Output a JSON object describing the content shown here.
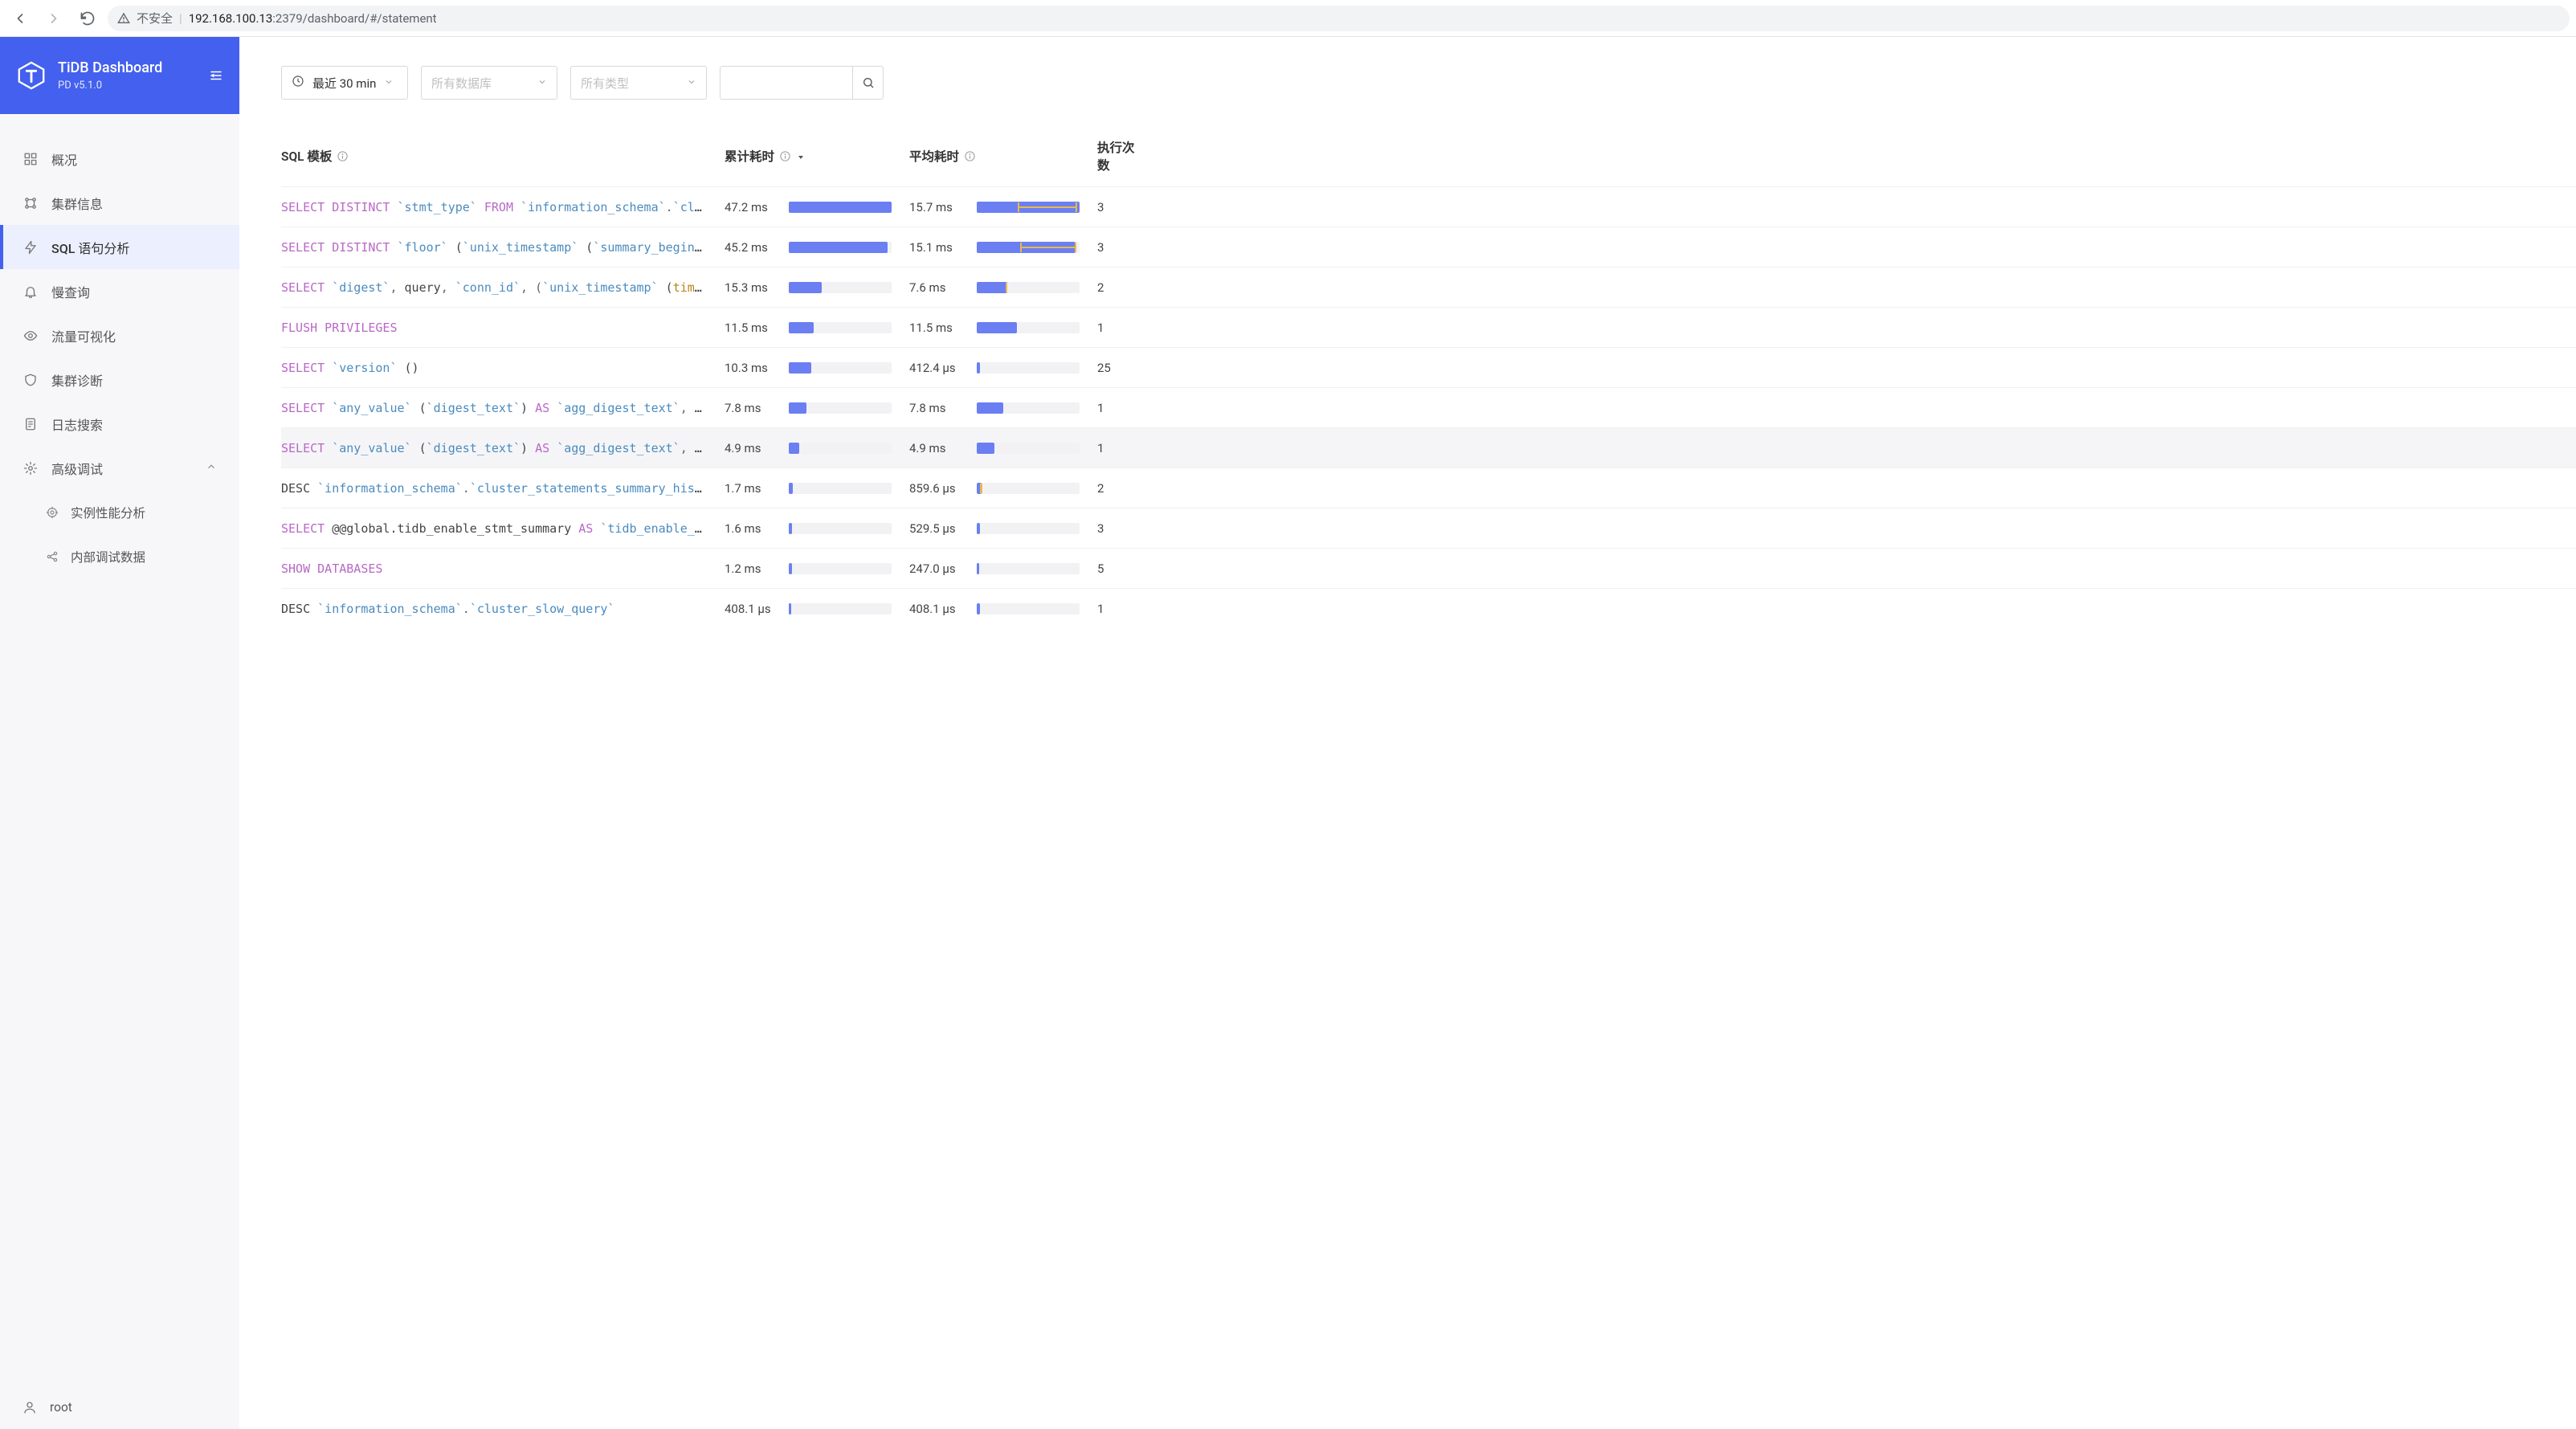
{
  "browser": {
    "insecure_label": "不安全",
    "url_host": "192.168.100.13",
    "url_port": ":2379",
    "url_path": "/dashboard/#/statement"
  },
  "sidebar": {
    "title": "TiDB Dashboard",
    "subtitle": "PD v5.1.0",
    "items": [
      {
        "label": "概况"
      },
      {
        "label": "集群信息"
      },
      {
        "label": "SQL 语句分析"
      },
      {
        "label": "慢查询"
      },
      {
        "label": "流量可视化"
      },
      {
        "label": "集群诊断"
      },
      {
        "label": "日志搜索"
      },
      {
        "label": "高级调试"
      }
    ],
    "sub_items": [
      {
        "label": "实例性能分析"
      },
      {
        "label": "内部调试数据"
      }
    ],
    "footer_user": "root"
  },
  "toolbar": {
    "time_label": "最近 30 min",
    "db_placeholder": "所有数据库",
    "type_placeholder": "所有类型"
  },
  "columns": {
    "sql": "SQL 模板",
    "sum": "累计耗时",
    "avg": "平均耗时",
    "count": "执行次数"
  },
  "chart_data": {
    "type": "table",
    "columns": [
      "sql_template",
      "sum_latency",
      "avg_latency",
      "exec_count"
    ],
    "max_sum_ms": 47.2,
    "max_avg_ms": 15.7,
    "rows": [
      {
        "sum": "47.2 ms",
        "sum_pct": 100,
        "avg": "15.7 ms",
        "avg_pct": 100,
        "whisker_lo": 40,
        "whisker_hi": 98,
        "count": "3"
      },
      {
        "sum": "45.2 ms",
        "sum_pct": 96,
        "avg": "15.1 ms",
        "avg_pct": 96,
        "whisker_lo": 42,
        "whisker_hi": 97,
        "count": "3"
      },
      {
        "sum": "15.3 ms",
        "sum_pct": 32,
        "avg": "7.6 ms",
        "avg_pct": 30,
        "whisker_lo": 28,
        "whisker_hi": 30,
        "count": "2"
      },
      {
        "sum": "11.5 ms",
        "sum_pct": 24,
        "avg": "11.5 ms",
        "avg_pct": 39,
        "count": "1"
      },
      {
        "sum": "10.3 ms",
        "sum_pct": 22,
        "avg": "412.4 µs",
        "avg_pct": 3,
        "count": "25"
      },
      {
        "sum": "7.8 ms",
        "sum_pct": 17,
        "avg": "7.8 ms",
        "avg_pct": 26,
        "count": "1"
      },
      {
        "sum": "4.9 ms",
        "sum_pct": 10,
        "avg": "4.9 ms",
        "avg_pct": 17,
        "count": "1",
        "hover": true
      },
      {
        "sum": "1.7 ms",
        "sum_pct": 4,
        "avg": "859.6 µs",
        "avg_pct": 5,
        "whisker_lo": 4,
        "whisker_hi": 5,
        "count": "2"
      },
      {
        "sum": "1.6 ms",
        "sum_pct": 3,
        "avg": "529.5 µs",
        "avg_pct": 3,
        "count": "3"
      },
      {
        "sum": "1.2 ms",
        "sum_pct": 3,
        "avg": "247.0 µs",
        "avg_pct": 2,
        "count": "5"
      },
      {
        "sum": "408.1 µs",
        "sum_pct": 2,
        "avg": "408.1 µs",
        "avg_pct": 3,
        "count": "1"
      }
    ]
  },
  "sql_rows": [
    {
      "tokens": [
        [
          "kw",
          "SELECT DISTINCT"
        ],
        [
          "plain",
          " "
        ],
        [
          "id",
          "`stmt_type`"
        ],
        [
          "plain",
          " "
        ],
        [
          "kw",
          "FROM"
        ],
        [
          "plain",
          " "
        ],
        [
          "id",
          "`information_schema`"
        ],
        [
          "op",
          "."
        ],
        [
          "id",
          "`clus…"
        ]
      ]
    },
    {
      "tokens": [
        [
          "kw",
          "SELECT DISTINCT"
        ],
        [
          "plain",
          " "
        ],
        [
          "id",
          "`floor`"
        ],
        [
          "plain",
          " ("
        ],
        [
          "id",
          "`unix_timestamp`"
        ],
        [
          "plain",
          " ("
        ],
        [
          "id",
          "`summary_begin_t…"
        ]
      ]
    },
    {
      "tokens": [
        [
          "kw",
          "SELECT"
        ],
        [
          "plain",
          " "
        ],
        [
          "id",
          "`digest`"
        ],
        [
          "op",
          ", "
        ],
        [
          "plain",
          "query"
        ],
        [
          "op",
          ", "
        ],
        [
          "id",
          "`conn_id`"
        ],
        [
          "op",
          ", ("
        ],
        [
          "id",
          "`unix_timestamp`"
        ],
        [
          "plain",
          " ("
        ],
        [
          "ytype",
          "time"
        ],
        [
          "plain",
          ")…"
        ]
      ]
    },
    {
      "tokens": [
        [
          "kw",
          "FLUSH PRIVILEGES"
        ]
      ]
    },
    {
      "tokens": [
        [
          "kw",
          "SELECT"
        ],
        [
          "plain",
          " "
        ],
        [
          "id",
          "`version`"
        ],
        [
          "plain",
          " ()"
        ]
      ]
    },
    {
      "tokens": [
        [
          "kw",
          "SELECT"
        ],
        [
          "plain",
          " "
        ],
        [
          "id",
          "`any_value`"
        ],
        [
          "plain",
          " ("
        ],
        [
          "id",
          "`digest_text`"
        ],
        [
          "plain",
          ") "
        ],
        [
          "kw",
          "AS"
        ],
        [
          "plain",
          " "
        ],
        [
          "id",
          "`agg_digest_text`"
        ],
        [
          "op",
          ", "
        ],
        [
          "id",
          "`a…"
        ]
      ]
    },
    {
      "tokens": [
        [
          "kw",
          "SELECT"
        ],
        [
          "plain",
          " "
        ],
        [
          "id",
          "`any_value`"
        ],
        [
          "plain",
          " ("
        ],
        [
          "id",
          "`digest_text`"
        ],
        [
          "plain",
          ") "
        ],
        [
          "kw",
          "AS"
        ],
        [
          "plain",
          " "
        ],
        [
          "id",
          "`agg_digest_text`"
        ],
        [
          "op",
          ", "
        ],
        [
          "id",
          "`a…"
        ]
      ]
    },
    {
      "tokens": [
        [
          "plain",
          "DESC "
        ],
        [
          "id",
          "`information_schema`"
        ],
        [
          "op",
          "."
        ],
        [
          "id",
          "`cluster_statements_summary_histo…"
        ]
      ]
    },
    {
      "tokens": [
        [
          "kw",
          "SELECT"
        ],
        [
          "plain",
          " @@global.tidb_enable_stmt_summary "
        ],
        [
          "kw",
          "AS"
        ],
        [
          "plain",
          " "
        ],
        [
          "id",
          "`tidb_enable_st…"
        ]
      ]
    },
    {
      "tokens": [
        [
          "kw",
          "SHOW DATABASES"
        ]
      ]
    },
    {
      "tokens": [
        [
          "plain",
          "DESC "
        ],
        [
          "id",
          "`information_schema`"
        ],
        [
          "op",
          "."
        ],
        [
          "id",
          "`cluster_slow_query`"
        ]
      ]
    }
  ]
}
